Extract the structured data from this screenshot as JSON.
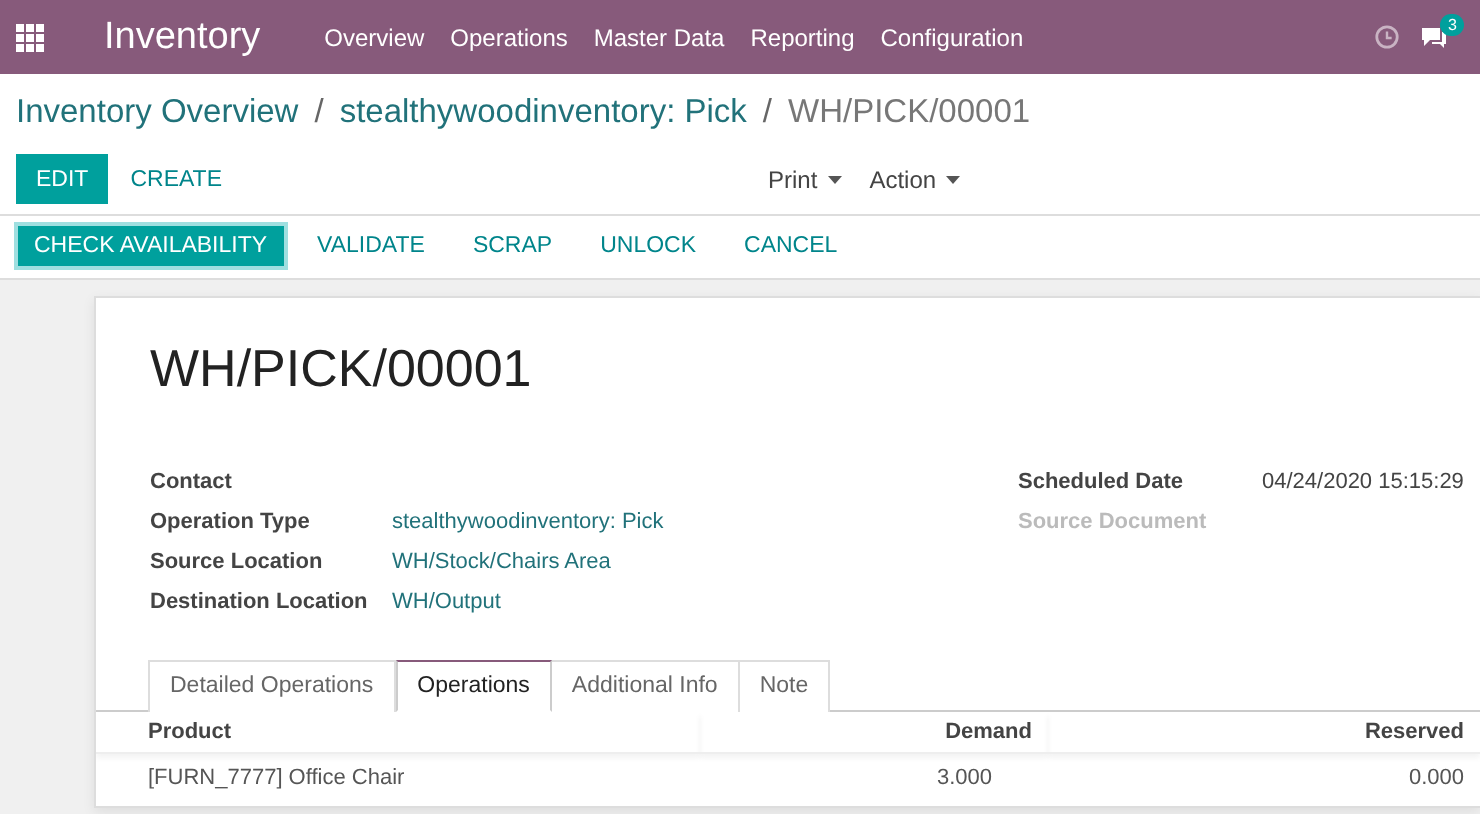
{
  "navbar": {
    "app_name": "Inventory",
    "menu": [
      "Overview",
      "Operations",
      "Master Data",
      "Reporting",
      "Configuration"
    ],
    "chat_badge": "3"
  },
  "breadcrumb": [
    {
      "label": "Inventory Overview",
      "kind": "link",
      "separator": "/"
    },
    {
      "label": "stealthywoodinventory: Pick",
      "kind": "link",
      "separator": "/"
    },
    {
      "label": "WH/PICK/00001",
      "kind": "current"
    }
  ],
  "buttons": [
    {
      "label": "EDIT",
      "kind": "primary"
    },
    {
      "label": "CREATE",
      "kind": "link"
    }
  ],
  "dropdowns": [
    "Print",
    "Action"
  ],
  "status_buttons": [
    {
      "label": "CHECK AVAILABILITY",
      "kind": "primary"
    },
    {
      "label": "VALIDATE",
      "kind": "link"
    },
    {
      "label": "SCRAP",
      "kind": "link"
    },
    {
      "label": "UNLOCK",
      "kind": "link"
    },
    {
      "label": "CANCEL",
      "kind": "link"
    }
  ],
  "sheet": {
    "title": "WH/PICK/00001",
    "left_fields": [
      {
        "label": "Contact",
        "disabled": false
      },
      {
        "label": "Operation Type",
        "value": "stealthywoodinventory: Pick",
        "disabled": false
      },
      {
        "label": "Source Location",
        "value": "WH/Stock/Chairs Area",
        "disabled": false
      },
      {
        "label": "Destination Location",
        "value": "WH/Output",
        "disabled": false
      }
    ],
    "right_fields": [
      {
        "label": "Scheduled Date",
        "value": "04/24/2020 15:15:29",
        "disabled": false
      },
      {
        "label": "Source Document",
        "disabled": true
      }
    ],
    "tabs": [
      {
        "label": "Detailed Operations",
        "selected": false
      },
      {
        "label": "Operations",
        "selected": true
      },
      {
        "label": "Additional Info",
        "selected": false
      },
      {
        "label": "Note",
        "selected": false
      }
    ],
    "table": {
      "columns": [
        "Product",
        "Demand",
        "Reserved"
      ],
      "rows": [
        [
          "[FURN_7777] Office Chair",
          "3.000",
          "0.000"
        ]
      ]
    }
  }
}
